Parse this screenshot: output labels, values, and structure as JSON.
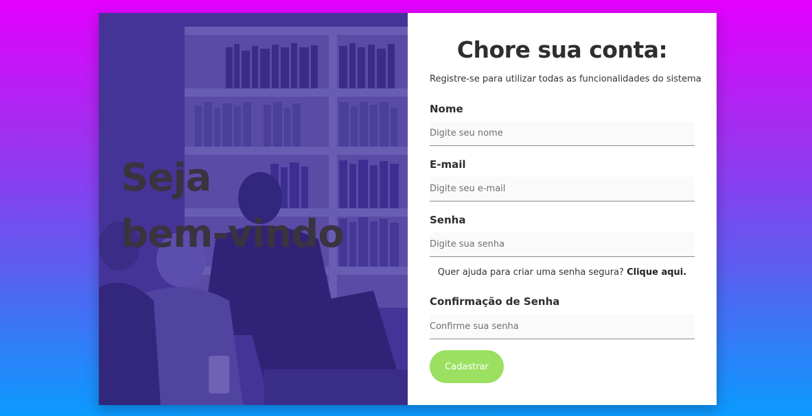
{
  "hero": {
    "title_line1": "Seja",
    "title_line2": "bem-vindo"
  },
  "form": {
    "title": "Chore sua conta:",
    "subtitle": "Registre-se para utilizar todas as funcionalidades do sistema",
    "fields": {
      "nome": {
        "label": "Nome",
        "placeholder": "Digite seu nome",
        "value": ""
      },
      "email": {
        "label": "E-mail",
        "placeholder": "Digite seu e-mail",
        "value": ""
      },
      "senha": {
        "label": "Senha",
        "placeholder": "Digite sua senha",
        "value": ""
      },
      "confirmacao": {
        "label": "Confirmação de Senha",
        "placeholder": "Confirme sua senha",
        "value": ""
      }
    },
    "help_text": "Quer ajuda para criar uma senha segura?",
    "help_link": "Clique aqui.",
    "submit_label": "Cadastrar"
  },
  "colors": {
    "background_top": "#e400ff",
    "background_bottom": "#0a9bff",
    "hero_overlay": "#3f2f8c",
    "submit_button": "#9be061"
  }
}
